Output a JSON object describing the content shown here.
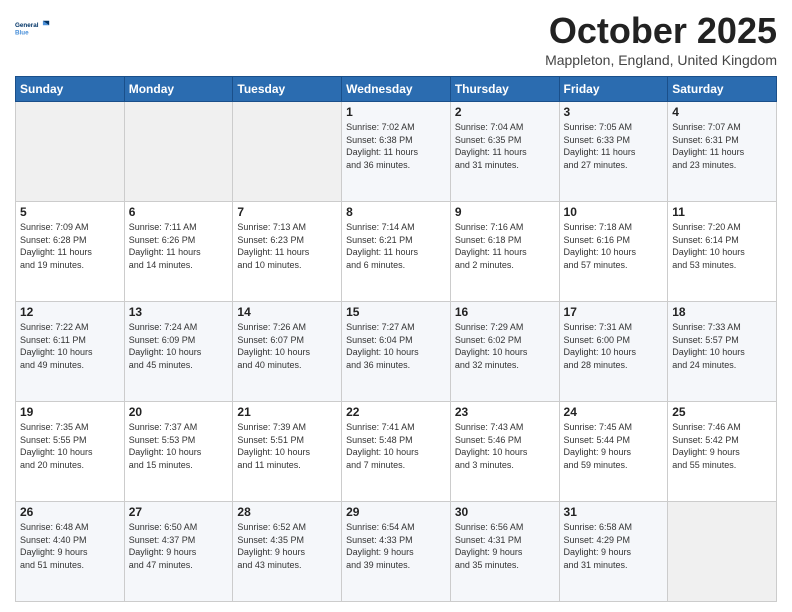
{
  "header": {
    "logo": {
      "line1": "General",
      "line2": "Blue"
    },
    "title": "October 2025",
    "location": "Mappleton, England, United Kingdom"
  },
  "days_of_week": [
    "Sunday",
    "Monday",
    "Tuesday",
    "Wednesday",
    "Thursday",
    "Friday",
    "Saturday"
  ],
  "weeks": [
    [
      {
        "day": "",
        "info": ""
      },
      {
        "day": "",
        "info": ""
      },
      {
        "day": "",
        "info": ""
      },
      {
        "day": "1",
        "info": "Sunrise: 7:02 AM\nSunset: 6:38 PM\nDaylight: 11 hours\nand 36 minutes."
      },
      {
        "day": "2",
        "info": "Sunrise: 7:04 AM\nSunset: 6:35 PM\nDaylight: 11 hours\nand 31 minutes."
      },
      {
        "day": "3",
        "info": "Sunrise: 7:05 AM\nSunset: 6:33 PM\nDaylight: 11 hours\nand 27 minutes."
      },
      {
        "day": "4",
        "info": "Sunrise: 7:07 AM\nSunset: 6:31 PM\nDaylight: 11 hours\nand 23 minutes."
      }
    ],
    [
      {
        "day": "5",
        "info": "Sunrise: 7:09 AM\nSunset: 6:28 PM\nDaylight: 11 hours\nand 19 minutes."
      },
      {
        "day": "6",
        "info": "Sunrise: 7:11 AM\nSunset: 6:26 PM\nDaylight: 11 hours\nand 14 minutes."
      },
      {
        "day": "7",
        "info": "Sunrise: 7:13 AM\nSunset: 6:23 PM\nDaylight: 11 hours\nand 10 minutes."
      },
      {
        "day": "8",
        "info": "Sunrise: 7:14 AM\nSunset: 6:21 PM\nDaylight: 11 hours\nand 6 minutes."
      },
      {
        "day": "9",
        "info": "Sunrise: 7:16 AM\nSunset: 6:18 PM\nDaylight: 11 hours\nand 2 minutes."
      },
      {
        "day": "10",
        "info": "Sunrise: 7:18 AM\nSunset: 6:16 PM\nDaylight: 10 hours\nand 57 minutes."
      },
      {
        "day": "11",
        "info": "Sunrise: 7:20 AM\nSunset: 6:14 PM\nDaylight: 10 hours\nand 53 minutes."
      }
    ],
    [
      {
        "day": "12",
        "info": "Sunrise: 7:22 AM\nSunset: 6:11 PM\nDaylight: 10 hours\nand 49 minutes."
      },
      {
        "day": "13",
        "info": "Sunrise: 7:24 AM\nSunset: 6:09 PM\nDaylight: 10 hours\nand 45 minutes."
      },
      {
        "day": "14",
        "info": "Sunrise: 7:26 AM\nSunset: 6:07 PM\nDaylight: 10 hours\nand 40 minutes."
      },
      {
        "day": "15",
        "info": "Sunrise: 7:27 AM\nSunset: 6:04 PM\nDaylight: 10 hours\nand 36 minutes."
      },
      {
        "day": "16",
        "info": "Sunrise: 7:29 AM\nSunset: 6:02 PM\nDaylight: 10 hours\nand 32 minutes."
      },
      {
        "day": "17",
        "info": "Sunrise: 7:31 AM\nSunset: 6:00 PM\nDaylight: 10 hours\nand 28 minutes."
      },
      {
        "day": "18",
        "info": "Sunrise: 7:33 AM\nSunset: 5:57 PM\nDaylight: 10 hours\nand 24 minutes."
      }
    ],
    [
      {
        "day": "19",
        "info": "Sunrise: 7:35 AM\nSunset: 5:55 PM\nDaylight: 10 hours\nand 20 minutes."
      },
      {
        "day": "20",
        "info": "Sunrise: 7:37 AM\nSunset: 5:53 PM\nDaylight: 10 hours\nand 15 minutes."
      },
      {
        "day": "21",
        "info": "Sunrise: 7:39 AM\nSunset: 5:51 PM\nDaylight: 10 hours\nand 11 minutes."
      },
      {
        "day": "22",
        "info": "Sunrise: 7:41 AM\nSunset: 5:48 PM\nDaylight: 10 hours\nand 7 minutes."
      },
      {
        "day": "23",
        "info": "Sunrise: 7:43 AM\nSunset: 5:46 PM\nDaylight: 10 hours\nand 3 minutes."
      },
      {
        "day": "24",
        "info": "Sunrise: 7:45 AM\nSunset: 5:44 PM\nDaylight: 9 hours\nand 59 minutes."
      },
      {
        "day": "25",
        "info": "Sunrise: 7:46 AM\nSunset: 5:42 PM\nDaylight: 9 hours\nand 55 minutes."
      }
    ],
    [
      {
        "day": "26",
        "info": "Sunrise: 6:48 AM\nSunset: 4:40 PM\nDaylight: 9 hours\nand 51 minutes."
      },
      {
        "day": "27",
        "info": "Sunrise: 6:50 AM\nSunset: 4:37 PM\nDaylight: 9 hours\nand 47 minutes."
      },
      {
        "day": "28",
        "info": "Sunrise: 6:52 AM\nSunset: 4:35 PM\nDaylight: 9 hours\nand 43 minutes."
      },
      {
        "day": "29",
        "info": "Sunrise: 6:54 AM\nSunset: 4:33 PM\nDaylight: 9 hours\nand 39 minutes."
      },
      {
        "day": "30",
        "info": "Sunrise: 6:56 AM\nSunset: 4:31 PM\nDaylight: 9 hours\nand 35 minutes."
      },
      {
        "day": "31",
        "info": "Sunrise: 6:58 AM\nSunset: 4:29 PM\nDaylight: 9 hours\nand 31 minutes."
      },
      {
        "day": "",
        "info": ""
      }
    ]
  ]
}
